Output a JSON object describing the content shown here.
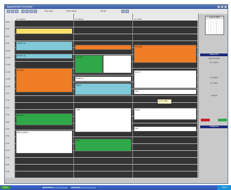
{
  "window": {
    "title": "Appointment Scheduler"
  },
  "toolbar": {
    "view_label": "Day View",
    "week_label": "Work Week",
    "month_label": "Month"
  },
  "columns": [
    {
      "header": "Dr. Adams"
    },
    {
      "header": "Dr. Baker"
    },
    {
      "header": "Dr. Clark"
    }
  ],
  "times": [
    "8:00",
    "8:30",
    "9:00",
    "9:30",
    "10:00",
    "10:30",
    "11:00",
    "11:30",
    "12:00",
    "12:30",
    "1:00",
    "1:30",
    "2:00",
    "2:30",
    "3:00",
    "3:30",
    "4:00",
    "4:30",
    "5:00",
    "5:30",
    "6:00",
    "6:30"
  ],
  "events": [
    {
      "label": "",
      "color": "#f7e16a"
    },
    {
      "label": "Check-up",
      "color": "#7fc9d8"
    },
    {
      "label": "Follow up",
      "color": "#7fc9d8"
    },
    {
      "label": "Surgery",
      "color": "#ee7d26"
    },
    {
      "label": "Consult",
      "color": "#2fa84a"
    },
    {
      "label": "",
      "color": "#ffffff"
    },
    {
      "label": "Meeting",
      "color": "#ffffff"
    },
    {
      "label": "",
      "color": "#ee7d26"
    },
    {
      "label": "Review",
      "color": "#2fa84a"
    },
    {
      "label": "Lunch",
      "color": "#ffffff"
    },
    {
      "label": "Exam",
      "color": "#7fc9d8"
    },
    {
      "label": "Therapy",
      "color": "#ee7d26"
    },
    {
      "label": "Visit",
      "color": "#ffffff"
    },
    {
      "label": "Call",
      "color": "#ffffff"
    },
    {
      "label": "Test",
      "color": "#2fa84a"
    },
    {
      "label": "Notes",
      "color": "#ffffff"
    },
    {
      "label": "New patient",
      "color": "#ffffff"
    },
    {
      "label": "Lab",
      "color": "#ffffff"
    }
  ],
  "popup": {
    "label": "Go to date"
  },
  "sidebar": {
    "calendar_title": "August 2004",
    "bar1": "Resources",
    "text1": "Appointments",
    "text2": "Dr. Adams",
    "text3": "Dr. Baker",
    "text4": "Dr. Clark",
    "text5": "Legend",
    "bar2": "Categories"
  },
  "taskbar": {
    "start": "start",
    "task1": "Appointment...",
    "task2": "Document1",
    "clock": "10:24"
  }
}
